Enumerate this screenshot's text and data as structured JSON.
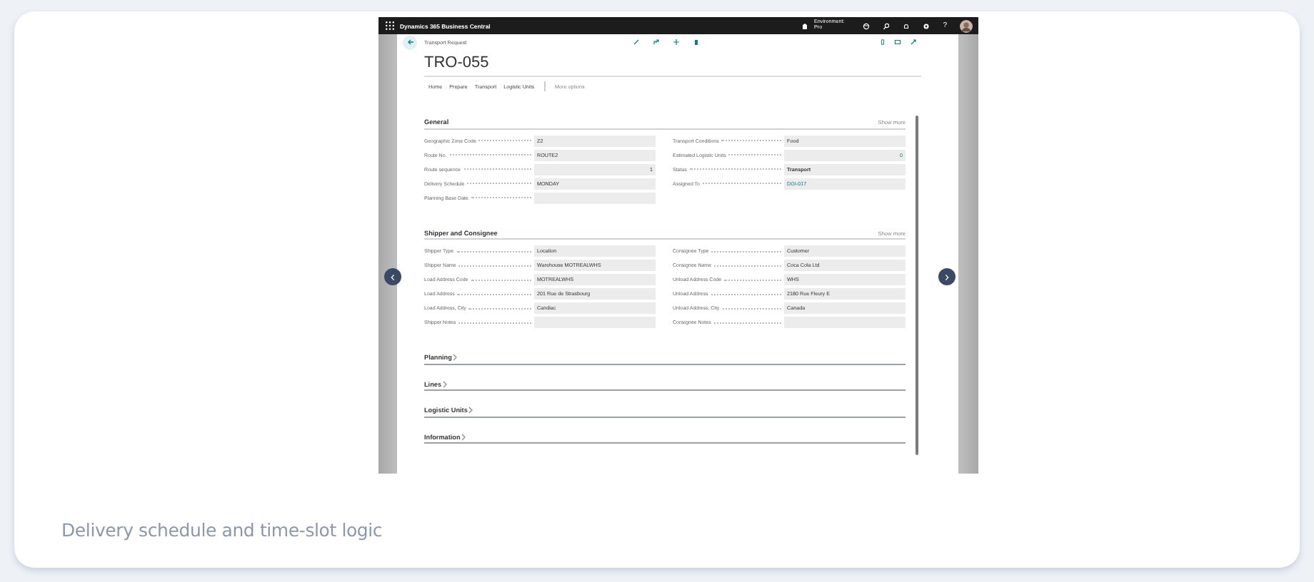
{
  "app_bar": {
    "title": "Dynamics 365 Business Central",
    "environment": [
      "Environment:",
      "Pro"
    ],
    "help": "?"
  },
  "page": {
    "breadcrumb": "Transport Request",
    "title": "TRO-055",
    "tabs": [
      "Home",
      "Prepare",
      "Transport",
      "Logistic Units"
    ],
    "more_options": "More options"
  },
  "sections": [
    {
      "title": "General",
      "expanded": true,
      "show_more": "Show more",
      "left": [
        {
          "label": "Geographic Zone Code",
          "value": "Z2",
          "kind": "text"
        },
        {
          "label": "Route No.",
          "value": "ROUTE2",
          "kind": "text"
        },
        {
          "label": "Route sequence",
          "value": "1",
          "kind": "number"
        },
        {
          "label": "Delivery Schedule",
          "value": "MONDAY",
          "kind": "text"
        },
        {
          "label": "Planning Base Date",
          "kind": "text"
        }
      ],
      "right": [
        {
          "label": "Transport Conditions",
          "value": "Food",
          "kind": "text"
        },
        {
          "label": "Estimated Logistic Units",
          "value": "0",
          "kind": "link_number"
        },
        {
          "label": "Status",
          "value": "Transport",
          "kind": "strong"
        },
        {
          "label": "Assigned To",
          "value": "DGI-017",
          "kind": "link"
        }
      ]
    },
    {
      "title": "Shipper and Consignee",
      "expanded": true,
      "show_more": "Show more",
      "left": [
        {
          "label": "Shipper Type",
          "value": "Location",
          "kind": "text"
        },
        {
          "label": "Shipper Name",
          "value": "Warehouse MOTREALWHS",
          "kind": "text"
        },
        {
          "label": "Load Address Code",
          "value": "MOTREALWHS",
          "kind": "text"
        },
        {
          "label": "Load Address",
          "value": "201 Rue de Strasbourg",
          "kind": "text"
        },
        {
          "label": "Load Address, City",
          "value": "Candiac",
          "kind": "text"
        },
        {
          "label": "Shipper Notes",
          "kind": "text"
        }
      ],
      "right": [
        {
          "label": "Consignee Type",
          "value": "Customer",
          "kind": "text"
        },
        {
          "label": "Consignee Name",
          "value": "Coca Cola Ltd",
          "kind": "text"
        },
        {
          "label": "Unload Address Code",
          "value": "WHS",
          "kind": "text"
        },
        {
          "label": "Unload Address",
          "value": "2180 Rue Fleury E",
          "kind": "text"
        },
        {
          "label": "Unload Address, City",
          "value": "Canada",
          "kind": "text"
        },
        {
          "label": "Consignee Notes",
          "kind": "text"
        }
      ]
    },
    {
      "title": "Planning",
      "expanded": false
    },
    {
      "title": "Lines",
      "expanded": false
    },
    {
      "title": "Logistic Units",
      "expanded": false
    },
    {
      "title": "Information",
      "expanded": false
    }
  ],
  "caption": "Delivery schedule and time-slot logic"
}
